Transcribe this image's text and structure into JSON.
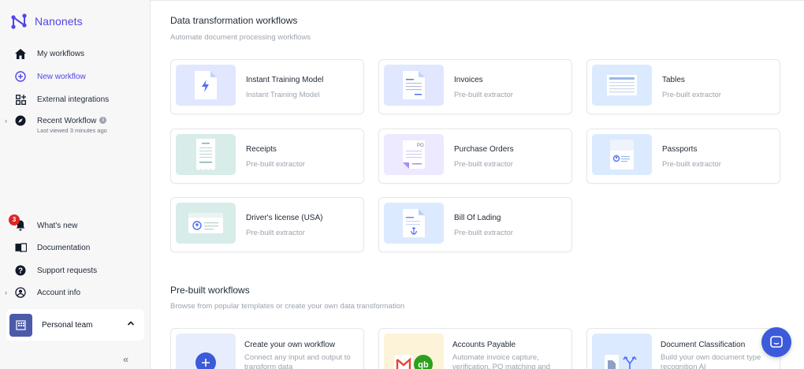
{
  "app": {
    "name": "Nanonets",
    "brand_color": "#4f46e5"
  },
  "sidebar": {
    "items": [
      {
        "label": "My workflows",
        "icon": "home-icon"
      },
      {
        "label": "New workflow",
        "icon": "plus-circle-icon"
      },
      {
        "label": "External integrations",
        "icon": "grid-plus-icon"
      },
      {
        "label": "Recent Workflow",
        "icon": "compass-icon",
        "sub": "Last viewed 3 minutes ago"
      }
    ],
    "bottom_items": [
      {
        "label": "What's new",
        "icon": "bell-icon",
        "badge": "3"
      },
      {
        "label": "Documentation",
        "icon": "book-icon"
      },
      {
        "label": "Support requests",
        "icon": "help-icon"
      },
      {
        "label": "Account info",
        "icon": "user-circle-icon"
      }
    ],
    "team": {
      "label": "Personal team"
    }
  },
  "data_transformation": {
    "title": "Data transformation workflows",
    "subtitle": "Automate document processing workflows",
    "cards": [
      {
        "title": "Instant Training Model",
        "desc": "Instant Training Model",
        "thumb_color": "#e0e7ff"
      },
      {
        "title": "Invoices",
        "desc": "Pre-built extractor",
        "thumb_color": "#e0e7ff"
      },
      {
        "title": "Tables",
        "desc": "Pre-built extractor",
        "thumb_color": "#dbeafe"
      },
      {
        "title": "Receipts",
        "desc": "Pre-built extractor",
        "thumb_color": "#d8ecea"
      },
      {
        "title": "Purchase Orders",
        "desc": "Pre-built extractor",
        "thumb_color": "#ede9fe"
      },
      {
        "title": "Passports",
        "desc": "Pre-built extractor",
        "thumb_color": "#dbeafe"
      },
      {
        "title": "Driver's license (USA)",
        "desc": "Pre-built extractor",
        "thumb_color": "#d8ecea"
      },
      {
        "title": "Bill Of Lading",
        "desc": "Pre-built extractor",
        "thumb_color": "#dbeafe"
      }
    ]
  },
  "prebuilt": {
    "title": "Pre-built workflows",
    "subtitle": "Browse from popular templates or create your own data transformation",
    "cards": [
      {
        "title": "Create your own workflow",
        "desc": "Connect any input and output to transform data"
      },
      {
        "title": "Accounts Payable",
        "desc": "Automate invoice capture, verification, PO matching and"
      },
      {
        "title": "Document Classification",
        "desc": "Build your own document type recognition AI"
      }
    ]
  }
}
